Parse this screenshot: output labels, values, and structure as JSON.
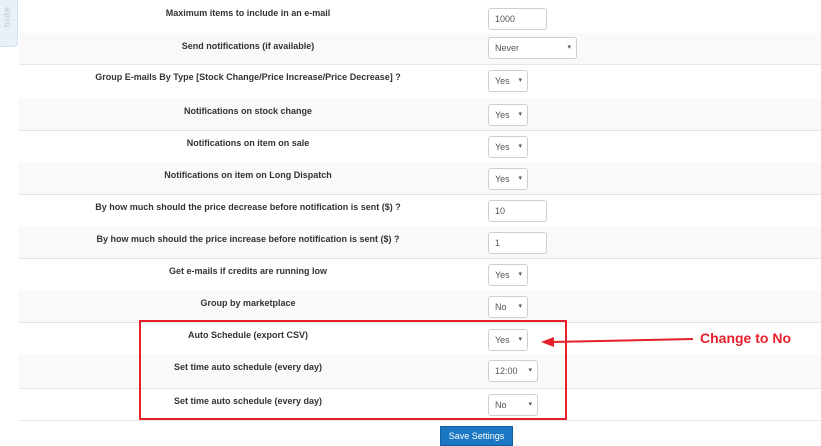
{
  "sidebar": {
    "hide_label": "hide"
  },
  "rows": [
    {
      "label": "Maximum items to include in an e-mail",
      "value": "1000"
    },
    {
      "label": "Send notifications (if available)",
      "value": "Never"
    },
    {
      "label": "Group E-mails By Type [Stock Change/Price Increase/Price Decrease] ?",
      "value": "Yes"
    },
    {
      "label": "Notifications on stock change",
      "value": "Yes"
    },
    {
      "label": "Notifications on item on sale",
      "value": "Yes"
    },
    {
      "label": "Notifications on item on Long Dispatch",
      "value": "Yes"
    },
    {
      "label": "By how much should the price decrease before notification is sent ($) ?",
      "value": "10"
    },
    {
      "label": "By how much should the price increase before notification is sent ($) ?",
      "value": "1"
    },
    {
      "label": "Get e-mails if credits are running low",
      "value": "Yes"
    },
    {
      "label": "Group by marketplace",
      "value": "No"
    },
    {
      "label": "Auto Schedule (export CSV)",
      "value": "Yes"
    },
    {
      "label": "Set time auto schedule (every day)",
      "value": "12:00"
    },
    {
      "label": "Set time auto schedule (every day)",
      "value": "No"
    }
  ],
  "save_button": "Save Settings",
  "annotation": {
    "text": "Change to No",
    "color": "#e8202a"
  },
  "icons": {
    "dropdown": "▾"
  }
}
